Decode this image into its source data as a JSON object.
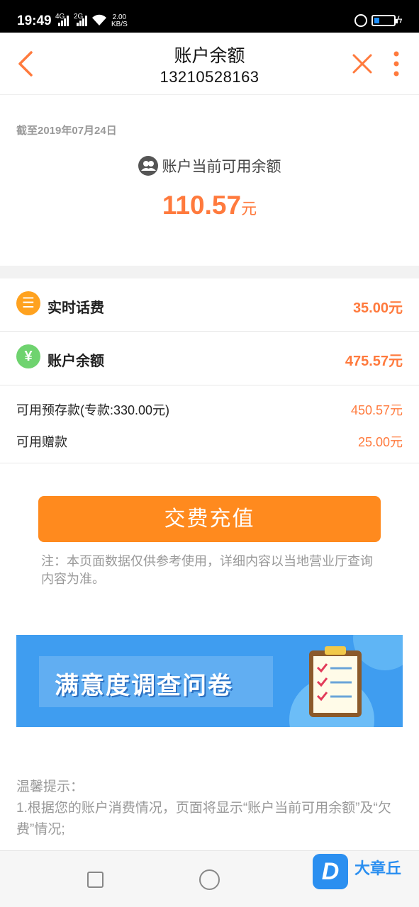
{
  "status_bar": {
    "time": "19:49",
    "signal1_label": "4G",
    "signal2_label": "2G",
    "speed_value": "2.00",
    "speed_unit": "KB/S",
    "battery_color": "#1e90ff"
  },
  "header": {
    "title": "账户余额",
    "phone": "13210528163",
    "back_icon": "chevron-left-icon",
    "close_icon": "close-icon",
    "more_icon": "more-vertical-icon",
    "accent_color": "#ff7a3d"
  },
  "summary": {
    "as_of": "截至2019年07月24日",
    "available_label": "账户当前可用余额",
    "available_amount": "110.57",
    "available_unit": "元"
  },
  "items": [
    {
      "icon": "list-icon",
      "icon_glyph": "☰",
      "icon_color": "#ffa21f",
      "label": "实时话费",
      "value": "35.00元"
    },
    {
      "icon": "yuan-icon",
      "icon_glyph": "¥",
      "icon_color": "#6fd36f",
      "label": "账户余额",
      "value": "475.57元"
    }
  ],
  "details": [
    {
      "label": "可用预存款(专款:330.00元)",
      "value": "450.57元"
    },
    {
      "label": "可用赠款",
      "value": "25.00元"
    }
  ],
  "pay_button": {
    "label": "交费充值",
    "color": "#ff8a1e"
  },
  "note": "注：本页面数据仅供参考使用，详细内容以当地营业厅查询内容为准。",
  "banner": {
    "text": "满意度调查问卷",
    "bg_color": "#3f9df0"
  },
  "tips": {
    "title": "温馨提示：",
    "line1": "1.根据您的账户消费情况，页面将显示“账户当前可用余额”及“欠费”情况;"
  },
  "watermark": {
    "logo_letter": "D",
    "text": "大章丘"
  }
}
